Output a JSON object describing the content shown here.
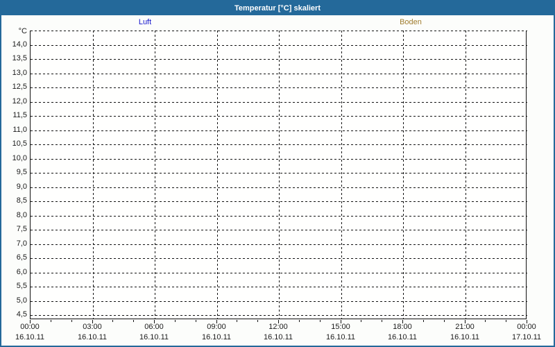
{
  "window": {
    "title": "Temperatur [°C] skaliert"
  },
  "colors": {
    "titlebar": "#24699a",
    "window_border": "#24699a",
    "luft": "#1414cc",
    "boden": "#a07c2e",
    "grid": "#111111",
    "axis_text": "#1a1a1a",
    "plot_background": "#fffffe"
  },
  "legend": {
    "items": [
      {
        "label": "Luft",
        "color": "#1414cc"
      },
      {
        "label": "Boden",
        "color": "#a07c2e"
      }
    ]
  },
  "chart_data": {
    "type": "line",
    "title": "Temperatur [°C] skaliert",
    "grid": "dashed",
    "legend_position": "top",
    "y_axis": {
      "unit": "°C",
      "min": 4.5,
      "max": 14.0,
      "step": 0.5,
      "tick_labels": [
        "14,0",
        "13,5",
        "13,0",
        "12,5",
        "12,0",
        "11,5",
        "11,0",
        "10,5",
        "10,0",
        "9,5",
        "9,0",
        "8,5",
        "8,0",
        "7,5",
        "7,0",
        "6,5",
        "6,0",
        "5,5",
        "5,0",
        "4,5"
      ]
    },
    "x_axis": {
      "tick_times": [
        "00:00",
        "03:00",
        "06:00",
        "09:00",
        "12:00",
        "15:00",
        "18:00",
        "21:00",
        "00:00"
      ],
      "tick_dates": [
        "16.10.11",
        "16.10.11",
        "16.10.11",
        "16.10.11",
        "16.10.11",
        "16.10.11",
        "16.10.11",
        "16.10.11",
        "17.10.11"
      ],
      "minor_ticks_per_hour": 1,
      "hours_span": 24
    },
    "series": [
      {
        "name": "Luft",
        "color": "#1414cc",
        "values": []
      },
      {
        "name": "Boden",
        "color": "#a07c2e",
        "values": []
      }
    ]
  }
}
